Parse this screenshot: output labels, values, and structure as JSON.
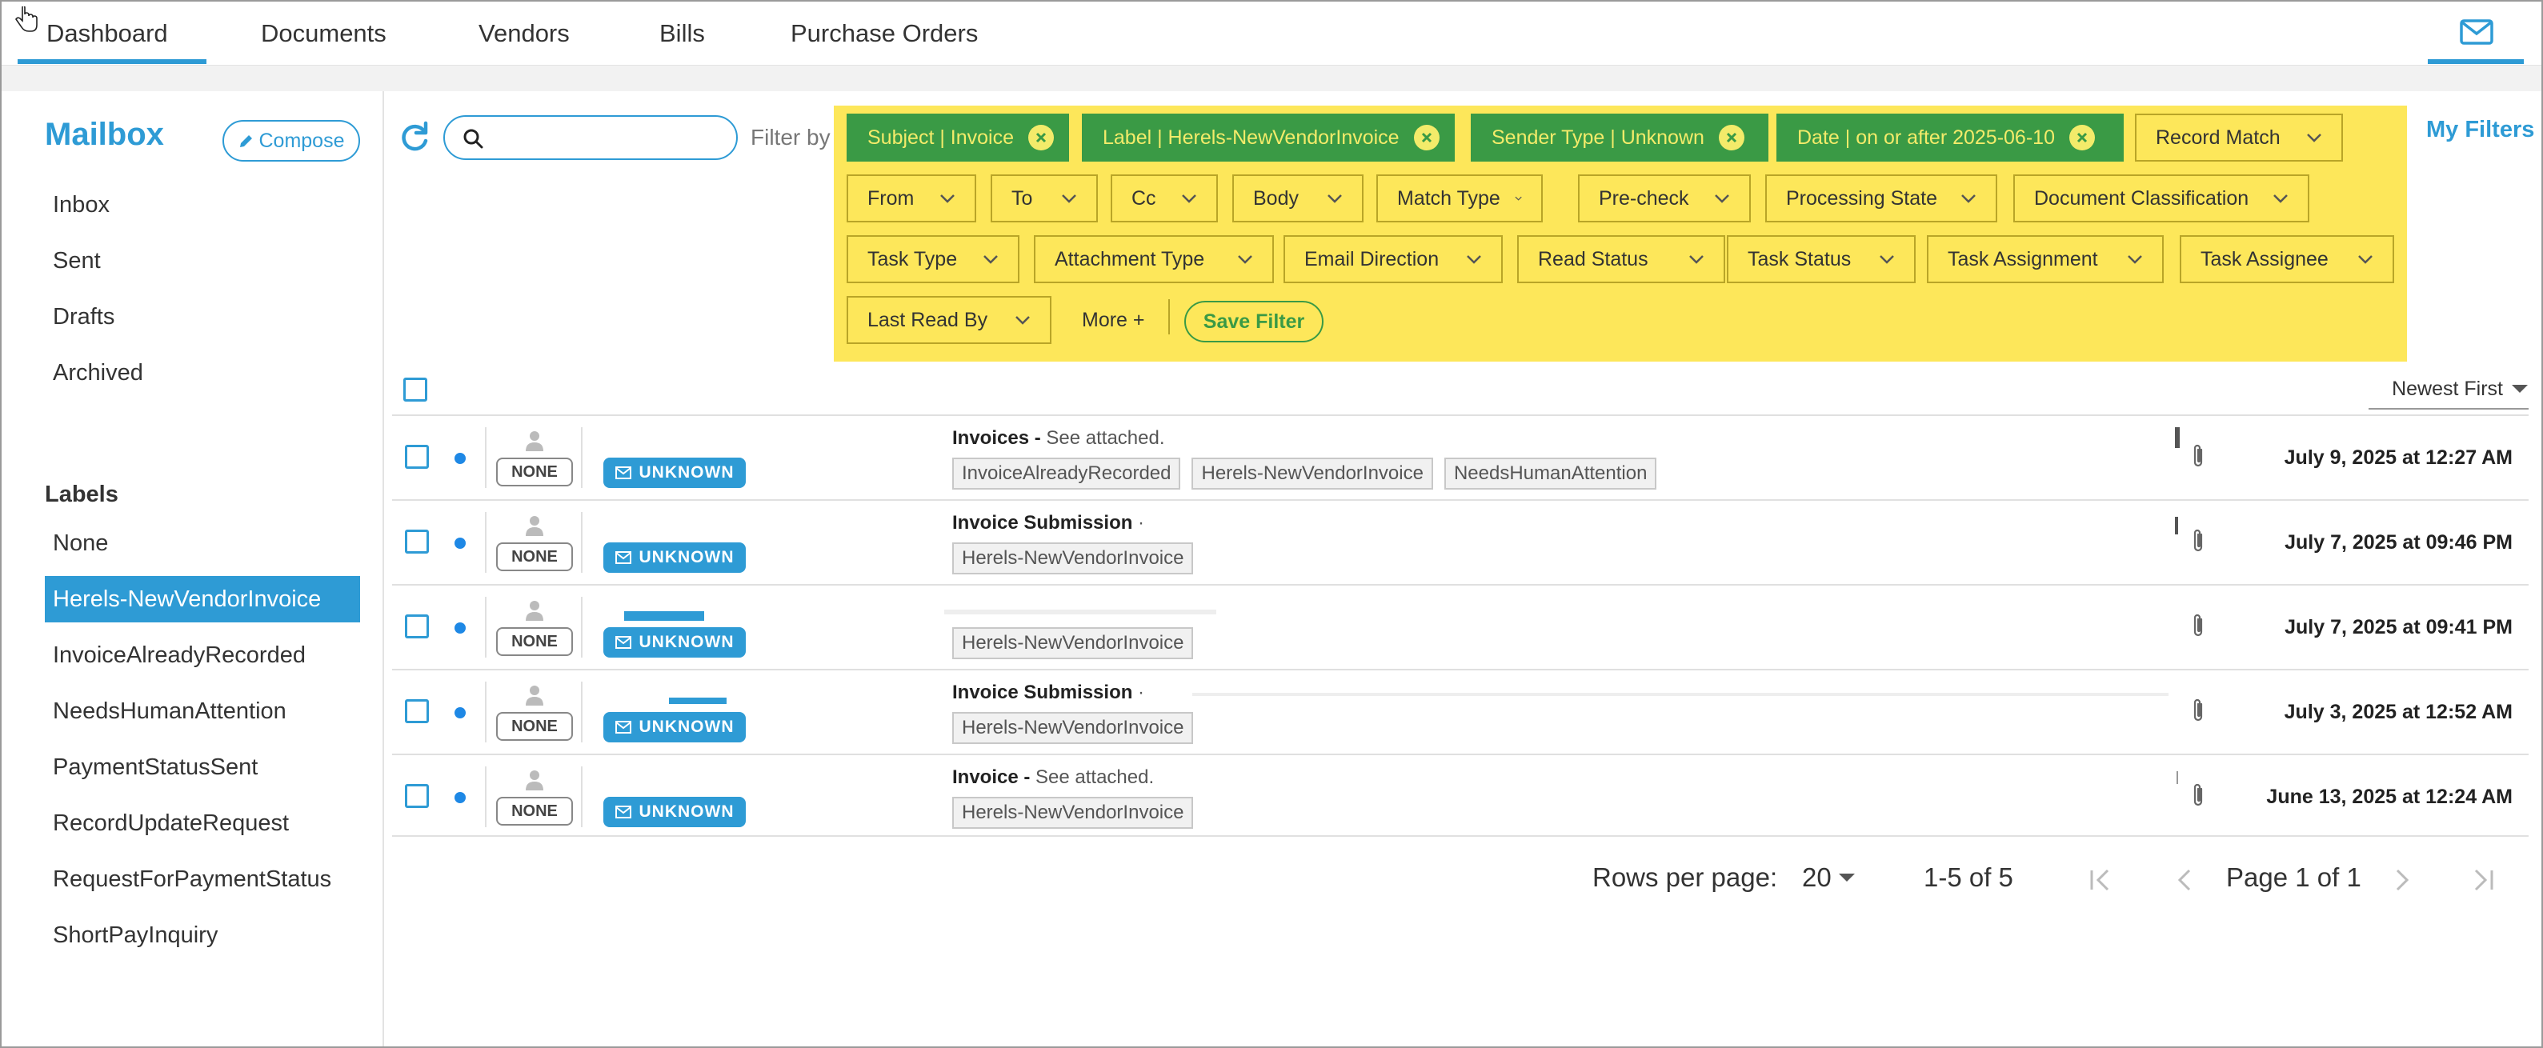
{
  "nav": {
    "tabs": [
      {
        "label": "Dashboard",
        "active": true
      },
      {
        "label": "Documents"
      },
      {
        "label": "Vendors"
      },
      {
        "label": "Bills"
      },
      {
        "label": "Purchase Orders"
      }
    ],
    "mail_icon": "envelope-icon"
  },
  "sidebar": {
    "title": "Mailbox",
    "compose_label": "Compose",
    "folders": [
      "Inbox",
      "Sent",
      "Drafts",
      "Archived"
    ],
    "labels_heading": "Labels",
    "labels": [
      "None",
      "Herels-NewVendorInvoice",
      "InvoiceAlreadyRecorded",
      "NeedsHumanAttention",
      "PaymentStatusSent",
      "RecordUpdateRequest",
      "RequestForPaymentStatus",
      "ShortPayInquiry"
    ],
    "active_label": "Herels-NewVendorInvoice"
  },
  "toolbar": {
    "search_value": "",
    "filter_by": "Filter by",
    "my_filters": "My Filters"
  },
  "filters": {
    "active": [
      "Subject | Invoice",
      "Label | Herels-NewVendorInvoice",
      "Sender Type | Unknown",
      "Date | on or after 2025-06-10"
    ],
    "dropdowns": [
      "Record Match",
      "From",
      "To",
      "Cc",
      "Body",
      "Match Type",
      "Pre-check",
      "Processing State",
      "Document Classification",
      "Task Type",
      "Attachment Type",
      "Email Direction",
      "Read Status",
      "Task Status",
      "Task Assignment",
      "Task Assignee",
      "Last Read By"
    ],
    "more": "More +",
    "save": "Save Filter"
  },
  "list": {
    "sort": "Newest First",
    "rows": [
      {
        "owner": "NONE",
        "sender_type": "UNKNOWN",
        "subject": "Invoices -",
        "preview": " See attached.",
        "tags": [
          "InvoiceAlreadyRecorded",
          "Herels-NewVendorInvoice",
          "NeedsHumanAttention"
        ],
        "date": "July 9, 2025 at 12:27 AM",
        "unread": true,
        "attachment": true
      },
      {
        "owner": "NONE",
        "sender_type": "UNKNOWN",
        "subject": "Invoice Submission",
        "preview": " ·",
        "tags": [
          "Herels-NewVendorInvoice"
        ],
        "date": "July 7, 2025 at 09:46 PM",
        "unread": true,
        "attachment": true
      },
      {
        "owner": "NONE",
        "sender_type": "UNKNOWN",
        "subject": "",
        "preview": "",
        "tags": [
          "Herels-NewVendorInvoice"
        ],
        "date": "July 7, 2025 at 09:41 PM",
        "unread": true,
        "attachment": true
      },
      {
        "owner": "NONE",
        "sender_type": "UNKNOWN",
        "subject": "Invoice Submission",
        "preview": " ·",
        "tags": [
          "Herels-NewVendorInvoice"
        ],
        "date": "July 3, 2025 at 12:52 AM",
        "unread": true,
        "attachment": true
      },
      {
        "owner": "NONE",
        "sender_type": "UNKNOWN",
        "subject": "Invoice -",
        "preview": " See attached.",
        "tags": [
          "Herels-NewVendorInvoice"
        ],
        "date": "June 13, 2025 at 12:24 AM",
        "unread": true,
        "attachment": true
      }
    ]
  },
  "pagination": {
    "rows_per_page_label": "Rows per page:",
    "rows_per_page": "20",
    "range": "1-5 of 5",
    "page": "Page 1 of 1"
  },
  "colors": {
    "accent": "#2e9bd5",
    "filter_panel": "#fde75a",
    "active_filter": "#3a9a45",
    "unread_dot": "#1e88e5"
  }
}
